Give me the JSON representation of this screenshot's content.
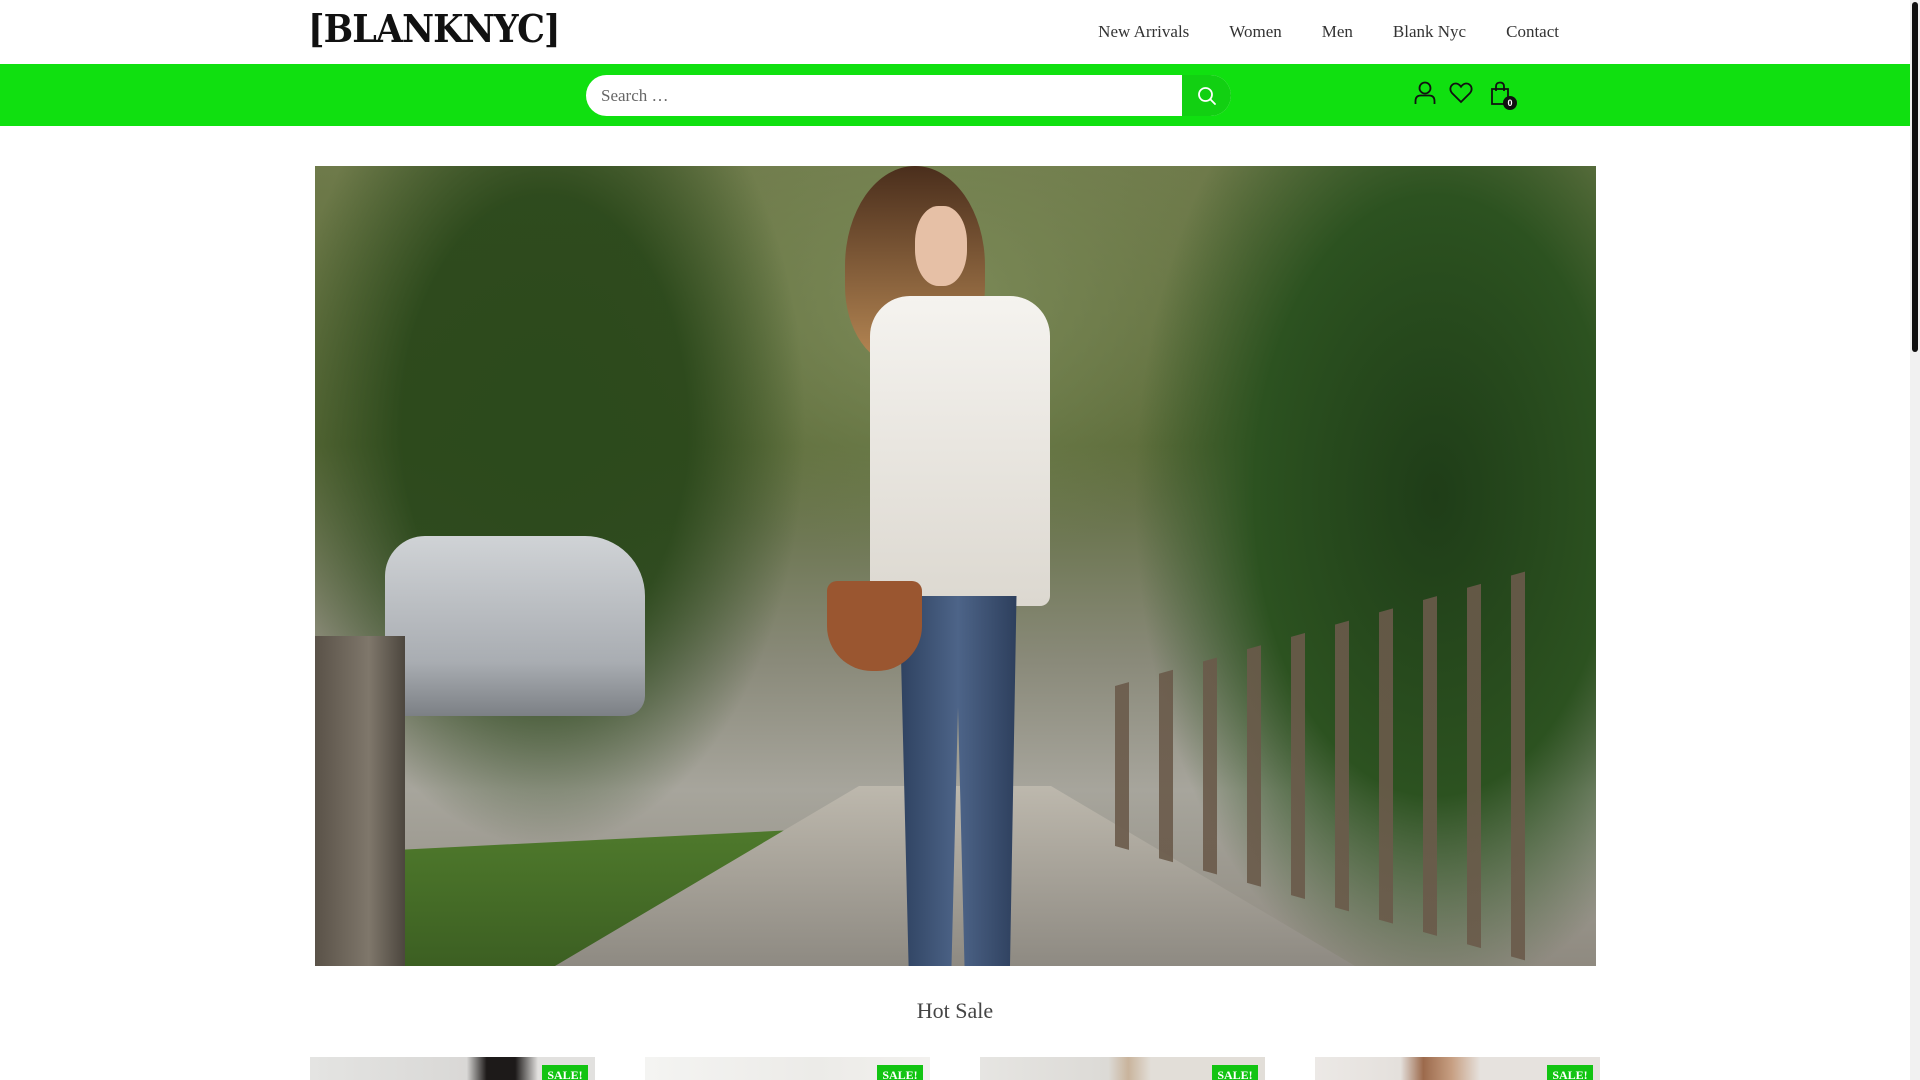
{
  "header": {
    "logo": "[BLANKNYC]",
    "nav": [
      "New Arrivals",
      "Women",
      "Men",
      "Blank Nyc",
      "Contact"
    ]
  },
  "search": {
    "placeholder": "Search …",
    "value": ""
  },
  "header_icons": {
    "account": "user-icon",
    "wishlist": "heart-icon",
    "cart": "shopping-bag-icon",
    "cart_count": "0"
  },
  "hero": {
    "image": "woman in white blouse and ripped jeans with brown crossbody bag on tree-lined sidewalk"
  },
  "hot_sale": {
    "title": "Hot Sale",
    "products": [
      {
        "badge": "SALE!"
      },
      {
        "badge": "SALE!"
      },
      {
        "badge": "SALE!"
      },
      {
        "badge": "SALE!"
      }
    ]
  },
  "colors": {
    "accent_green": "#10e010",
    "badge_green": "#12c412"
  }
}
